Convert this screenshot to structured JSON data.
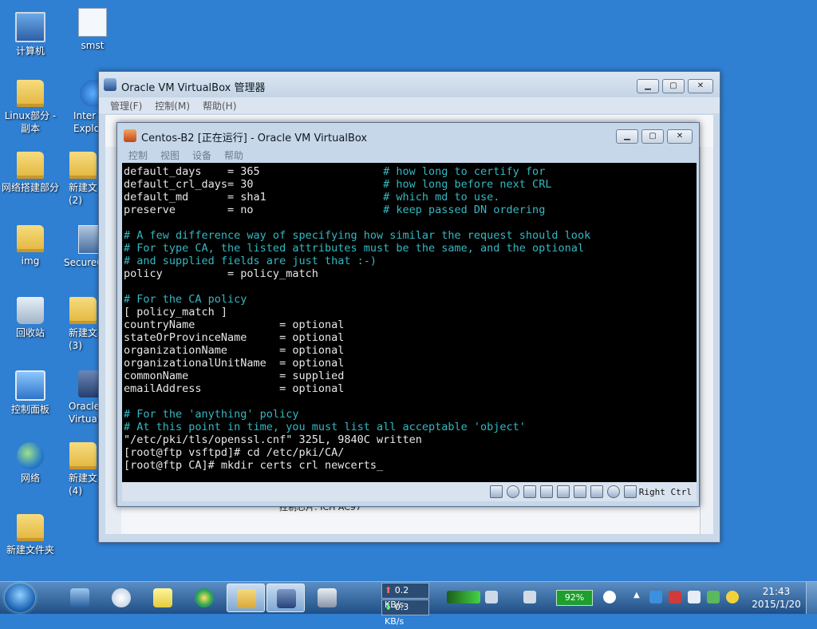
{
  "desktop": {
    "icons": [
      {
        "label": "计算机",
        "icon": "computer-icon"
      },
      {
        "label": "smst",
        "icon": "file-shortcut-icon"
      },
      {
        "label": "Linux部分 - 副本",
        "icon": "folder-icon"
      },
      {
        "label": "Inter Explo",
        "icon": "internet-explorer-icon"
      },
      {
        "label": "网络搭建部分",
        "icon": "folder-icon"
      },
      {
        "label": "新建文 (2)",
        "icon": "folder-icon"
      },
      {
        "label": "img",
        "icon": "folder-icon"
      },
      {
        "label": "SecureC",
        "icon": "securecrt-icon"
      },
      {
        "label": "回收站",
        "icon": "recycle-bin-icon"
      },
      {
        "label": "新建文 (3)",
        "icon": "folder-icon"
      },
      {
        "label": "控制面板",
        "icon": "control-panel-icon"
      },
      {
        "label": "Oracle Virtual",
        "icon": "virtualbox-icon"
      },
      {
        "label": "网络",
        "icon": "network-icon"
      },
      {
        "label": "新建文 (4)",
        "icon": "folder-icon"
      },
      {
        "label": "新建文件夹",
        "icon": "folder-icon"
      }
    ]
  },
  "manager_window": {
    "title": "Oracle VM VirtualBox 管理器",
    "menu": [
      "管理(F)",
      "控制(M)",
      "帮助(H)"
    ],
    "detail_text": "控制芯片:     ICH AC97"
  },
  "vm_window": {
    "title": "Centos-B2 [正在运行] - Oracle VM VirtualBox",
    "menu": [
      "控制",
      "视图",
      "设备",
      "帮助"
    ],
    "host_key": "Right Ctrl"
  },
  "terminal": {
    "lines": [
      {
        "text": "default_days    = 365",
        "comment": "# how long to certify for"
      },
      {
        "text": "default_crl_days= 30",
        "comment": "# how long before next CRL"
      },
      {
        "text": "default_md      = sha1",
        "comment": "# which md to use."
      },
      {
        "text": "preserve        = no",
        "comment": "# keep passed DN ordering"
      },
      {
        "text": "",
        "comment": ""
      },
      {
        "text": "",
        "comment": "# A few difference way of specifying how similar the request should look"
      },
      {
        "text": "",
        "comment": "# For type CA, the listed attributes must be the same, and the optional"
      },
      {
        "text": "",
        "comment": "# and supplied fields are just that :-)"
      },
      {
        "text": "policy          = policy_match",
        "comment": ""
      },
      {
        "text": "",
        "comment": ""
      },
      {
        "text": "",
        "comment": "# For the CA policy"
      },
      {
        "text": "[ policy_match ]",
        "comment": ""
      },
      {
        "text": "countryName             = optional",
        "comment": ""
      },
      {
        "text": "stateOrProvinceName     = optional",
        "comment": ""
      },
      {
        "text": "organizationName        = optional",
        "comment": ""
      },
      {
        "text": "organizationalUnitName  = optional",
        "comment": ""
      },
      {
        "text": "commonName              = supplied",
        "comment": ""
      },
      {
        "text": "emailAddress            = optional",
        "comment": ""
      },
      {
        "text": "",
        "comment": ""
      },
      {
        "text": "",
        "comment": "# For the 'anything' policy"
      },
      {
        "text": "",
        "comment": "# At this point in time, you must list all acceptable 'object'"
      },
      {
        "text": "\"/etc/pki/tls/openssl.cnf\" 325L, 9840C written",
        "comment": ""
      },
      {
        "text": "[root@ftp vsftpd]# cd /etc/pki/CA/",
        "comment": ""
      },
      {
        "text": "[root@ftp CA]# mkdir certs crl newcerts_",
        "comment": ""
      }
    ]
  },
  "taskbar": {
    "net_up": "0.2 KB/s",
    "net_down": "0.3 KB/s",
    "battery": "92%",
    "time": "21:43",
    "date": "2015/1/20"
  },
  "colors": {
    "desktop": "#2f7fd2",
    "terminal_bg": "#000000",
    "terminal_text": "#e8e8e8",
    "terminal_comment": "#34b8c2"
  }
}
